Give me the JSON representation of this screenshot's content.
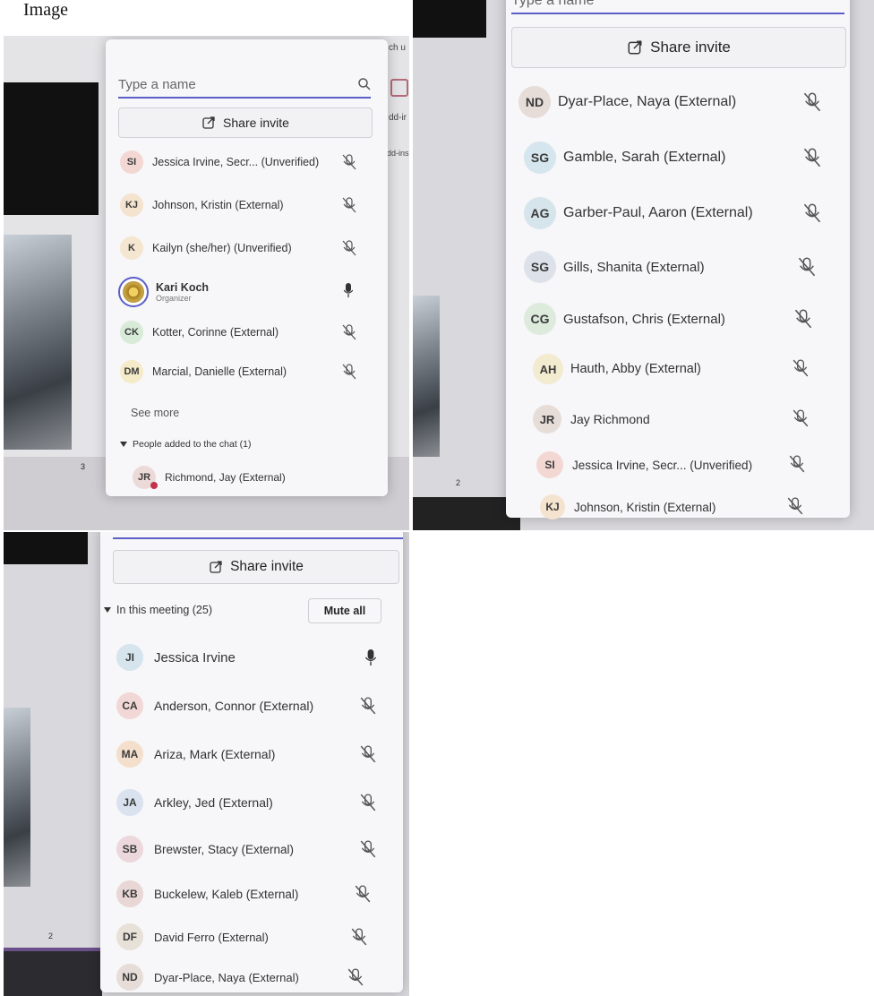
{
  "caption": "Image",
  "colors": {
    "accent": "#5b5fc7",
    "panel": "#f7f6f8",
    "status_dot": "#c4314b"
  },
  "shot1": {
    "search_placeholder": "Type a name",
    "share_label": "Share invite",
    "bg_snippets": [
      "ch u",
      "dd-ir",
      "dd-ins",
      "3"
    ],
    "participants": [
      {
        "initials": "SI",
        "name": "Jessica Irvine, Secr... (Unverified)",
        "color": "#f3d7d3"
      },
      {
        "initials": "KJ",
        "name": "Johnson, Kristin (External)",
        "color": "#f4e3cf"
      },
      {
        "initials": "K",
        "name": "Kailyn (she/her) (Unverified)",
        "color": "#f4e6d0"
      },
      {
        "initials": "",
        "name": "Kari Koch",
        "role": "Organizer",
        "color": "#c9a646"
      },
      {
        "initials": "CK",
        "name": "Kotter, Corinne (External)",
        "color": "#d8ead8"
      },
      {
        "initials": "DM",
        "name": "Marcial, Danielle (External)",
        "color": "#f5ebc9"
      }
    ],
    "see_more": "See more",
    "section_label": "People added to the chat (1)",
    "chat_person": {
      "initials": "JR",
      "name": "Richmond, Jay (External)",
      "color": "#ecdad8"
    }
  },
  "shot2": {
    "search_placeholder": "Type a name",
    "share_label": "Share invite",
    "bg_snippets": [
      "2"
    ],
    "participants": [
      {
        "initials": "ND",
        "name": "Dyar-Place, Naya (External)",
        "color": "#e6ddd8"
      },
      {
        "initials": "SG",
        "name": "Gamble, Sarah (External)",
        "color": "#d6e6ee"
      },
      {
        "initials": "AG",
        "name": "Garber-Paul, Aaron (External)",
        "color": "#d6e4ec"
      },
      {
        "initials": "SG",
        "name": "Gills, Shanita (External)",
        "color": "#dde2ea"
      },
      {
        "initials": "CG",
        "name": "Gustafson, Chris (External)",
        "color": "#dcebdc"
      },
      {
        "initials": "AH",
        "name": "Hauth, Abby (External)",
        "color": "#f2ebd0"
      },
      {
        "initials": "JR",
        "name": "Jay Richmond",
        "color": "#e6ddd8"
      },
      {
        "initials": "SI",
        "name": "Jessica Irvine, Secr... (Unverified)",
        "color": "#f3d7d3"
      },
      {
        "initials": "KJ",
        "name": "Johnson, Kristin (External)",
        "color": "#f4e3cf"
      }
    ]
  },
  "shot3": {
    "share_label": "Share invite",
    "section_label": "In this meeting (25)",
    "mute_all": "Mute all",
    "bg_snippets": [
      "2"
    ],
    "participants": [
      {
        "initials": "JI",
        "name": "Jessica Irvine",
        "color": "#d6e4ee",
        "mic": "on"
      },
      {
        "initials": "CA",
        "name": "Anderson, Connor (External)",
        "color": "#f1d8d6"
      },
      {
        "initials": "MA",
        "name": "Ariza, Mark (External)",
        "color": "#f3dfcc"
      },
      {
        "initials": "JA",
        "name": "Arkley, Jed (External)",
        "color": "#d9e2ee"
      },
      {
        "initials": "SB",
        "name": "Brewster, Stacy (External)",
        "color": "#ecd8dc"
      },
      {
        "initials": "KB",
        "name": "Buckelew, Kaleb (External)",
        "color": "#e8d7d5"
      },
      {
        "initials": "DF",
        "name": "David Ferro (External)",
        "color": "#e8e1d8"
      },
      {
        "initials": "ND",
        "name": "Dyar-Place, Naya (External)",
        "color": "#e6ddd8"
      }
    ]
  }
}
